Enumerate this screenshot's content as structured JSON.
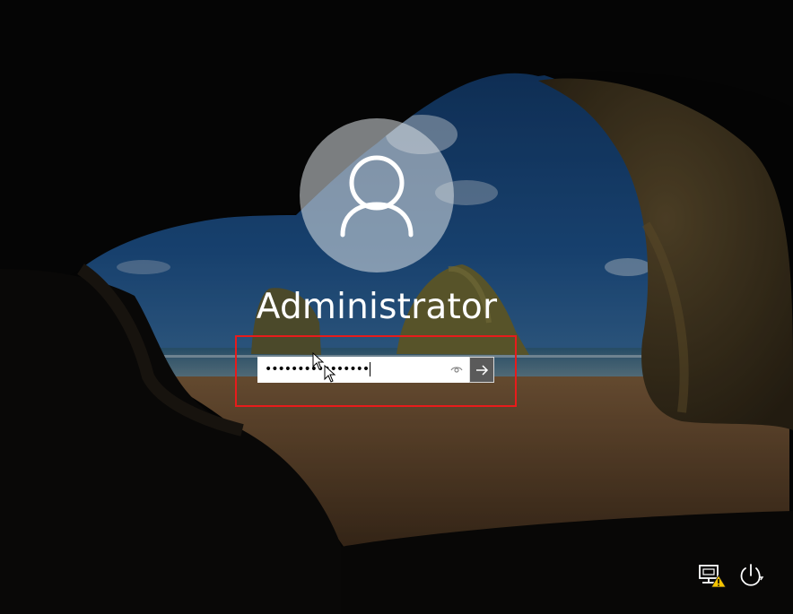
{
  "user": {
    "name": "Administrator"
  },
  "password_field": {
    "masked_value": "••••••••••••••••"
  },
  "icons": {
    "avatar": "user-silhouette-icon",
    "reveal": "eye-icon",
    "submit": "arrow-right-icon",
    "network": "network-warning-icon",
    "power": "power-icon"
  },
  "colors": {
    "highlight": "#e81b1b",
    "submit_bg": "#5a5a5a",
    "warning": "#f5c400"
  }
}
